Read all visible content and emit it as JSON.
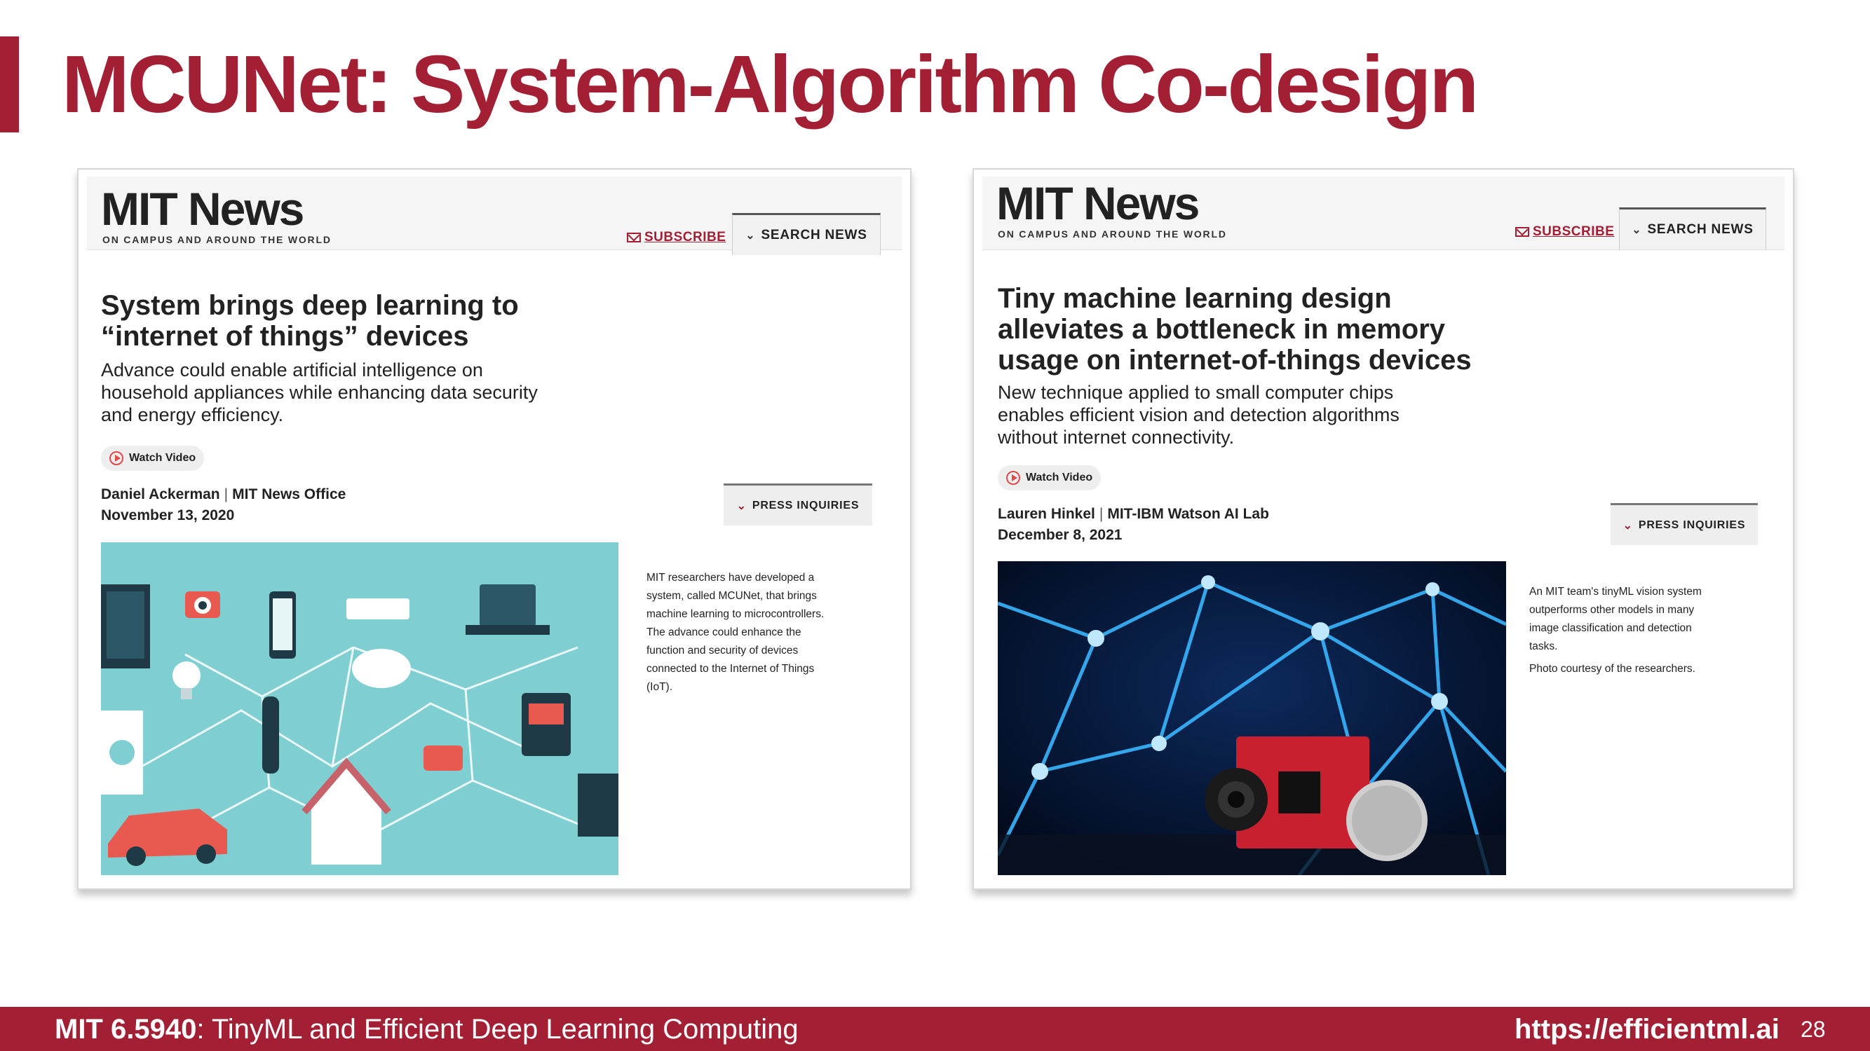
{
  "slide": {
    "title": "MCUNet: System-Algorithm Co-design",
    "accent_color": "#a31f34"
  },
  "articles": [
    {
      "logo": "MIT News",
      "tagline": "ON CAMPUS AND AROUND THE WORLD",
      "subscribe": "SUBSCRIBE",
      "search": "SEARCH NEWS",
      "headline_line1": "System brings deep learning to",
      "headline_line2": "“internet of things” devices",
      "dek_line1": "Advance could enable artificial intelligence on",
      "dek_line2": "household appliances while enhancing data security",
      "dek_line3": "and energy efficiency.",
      "watch_video": "Watch Video",
      "author": "Daniel Ackerman",
      "affiliation": "MIT News Office",
      "date": "November 13, 2020",
      "press": "PRESS INQUIRIES",
      "image_icon": "iot-devices-illustration",
      "caption_lines": [
        "MIT researchers have developed a",
        "system, called MCUNet, that brings",
        "machine learning to microcontrollers.",
        "The advance could enhance the",
        "function and security of devices",
        "connected to the Internet of Things",
        "(IoT)."
      ]
    },
    {
      "logo": "MIT News",
      "tagline": "ON CAMPUS AND AROUND THE WORLD",
      "subscribe": "SUBSCRIBE",
      "search": "SEARCH NEWS",
      "headline_line1": "Tiny machine learning design",
      "headline_line2": "alleviates a bottleneck in memory",
      "headline_line3": "usage on internet-of-things devices",
      "dek_line1": "New technique applied to small computer chips",
      "dek_line2": "enables efficient vision and detection algorithms",
      "dek_line3": "without internet connectivity.",
      "watch_video": "Watch Video",
      "author": "Lauren Hinkel",
      "affiliation": "MIT-IBM Watson AI Lab",
      "date": "December 8, 2021",
      "press": "PRESS INQUIRIES",
      "image_icon": "microcontroller-network-photo",
      "caption_lines": [
        "An MIT team's tinyML vision system",
        "outperforms other models in many",
        "image classification and detection",
        "tasks."
      ],
      "credit": "Photo courtesy of the researchers."
    }
  ],
  "footer": {
    "course_code": "MIT 6.5940",
    "course_name": ": TinyML and Efficient Deep Learning Computing",
    "url": "https://efficientml.ai",
    "page": "28"
  }
}
